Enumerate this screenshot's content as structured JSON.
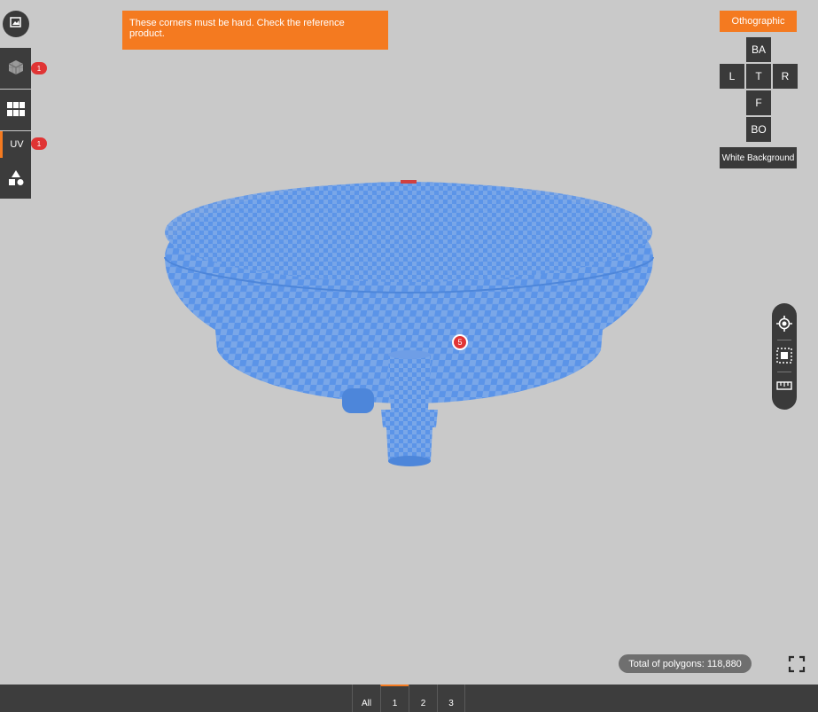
{
  "note": {
    "text": "These corners must be hard. Check the reference product."
  },
  "left_toolbar": {
    "items": [
      {
        "icon": "gallery-icon"
      },
      {
        "icon": "mesh-cube-icon",
        "badge": "1"
      },
      {
        "icon": "grid-icon"
      },
      {
        "label": "UV",
        "badge": "1"
      },
      {
        "icon": "shapes-icon"
      }
    ]
  },
  "ortho": {
    "title": "Othographic",
    "views": {
      "back": "BA",
      "left": "L",
      "top": "T",
      "right": "R",
      "front": "F",
      "bottom": "BO"
    },
    "white_background": "White Background"
  },
  "right_tools": [
    "locate-icon",
    "frame-select-icon",
    "ruler-icon"
  ],
  "viewport": {
    "marker": "5",
    "accent": "#f47a20",
    "mesh_color": "#5b94e8",
    "checker_color": "#7aa7e8"
  },
  "status": {
    "polygons": "Total of polygons: 118,880"
  },
  "bottom_tabs": [
    "All",
    "1",
    "2",
    "3"
  ],
  "active_tab": "1"
}
